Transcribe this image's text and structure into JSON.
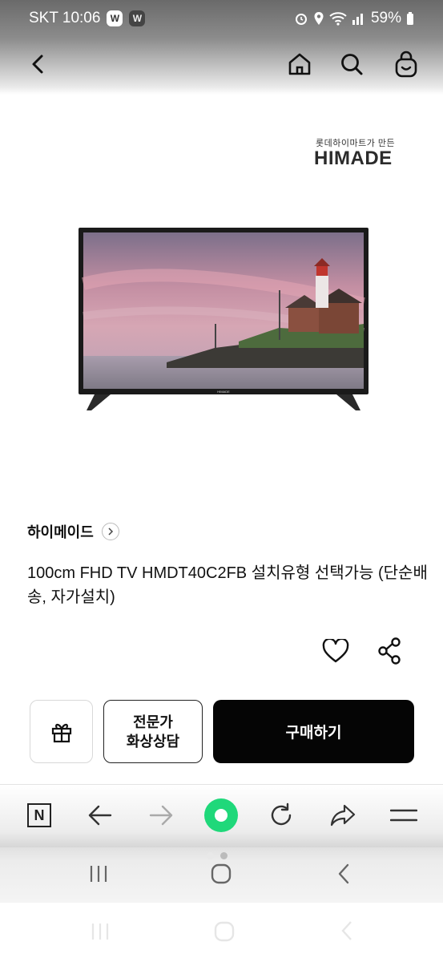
{
  "status_bar": {
    "carrier_time": "SKT 10:06",
    "badge_1": "W",
    "badge_2": "W",
    "battery": "59%"
  },
  "header": {
    "back_icon": "back-arrow-icon",
    "home_icon": "home-icon",
    "search_icon": "search-icon",
    "cart_icon": "shopping-bag-icon"
  },
  "brand_logo": {
    "subtitle": "롯데하이마트가 만든",
    "name": "HIMADE"
  },
  "product": {
    "brand": "하이메이드",
    "title": "100cm FHD TV HMDT40C2FB 설치유형 선택가능 (단순배송, 자가설치)",
    "tv_logo": "HIMADE"
  },
  "actions": {
    "gift_icon": "gift-icon",
    "consult_line1": "전문가",
    "consult_line2": "화상상담",
    "buy_label": "구매하기"
  },
  "browser_toolbar": {
    "tab_label": "N",
    "accent_color": "#1fd87a"
  },
  "colors": {
    "buy_button_bg": "#050505",
    "text": "#111111"
  }
}
